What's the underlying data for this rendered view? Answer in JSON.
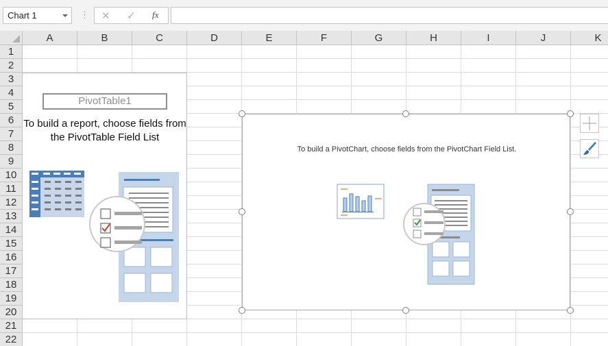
{
  "name_box": {
    "value": "Chart 1"
  },
  "formula_bar": {
    "fx_label": "fx",
    "cancel_glyph": "✕",
    "enter_glyph": "✓",
    "dots": "⋮",
    "value": ""
  },
  "columns": [
    "A",
    "B",
    "C",
    "D",
    "E",
    "F",
    "G",
    "H",
    "I",
    "J",
    "K"
  ],
  "rows": [
    "1",
    "2",
    "3",
    "4",
    "5",
    "6",
    "7",
    "8",
    "9",
    "10",
    "11",
    "12",
    "13",
    "14",
    "15",
    "16",
    "17",
    "18",
    "19",
    "20",
    "21",
    "22"
  ],
  "pivot_table": {
    "name": "PivotTable1",
    "instruction": "To build a report, choose fields from the PivotTable Field List"
  },
  "pivot_chart": {
    "instruction": "To build a PivotChart, choose fields from the PivotChart Field List."
  },
  "side_buttons": [
    {
      "icon": "plus-icon",
      "purpose": "chart-elements"
    },
    {
      "icon": "paintbrush-icon",
      "purpose": "chart-styles"
    }
  ],
  "colors": {
    "accent_blue": "#4a7ebb",
    "panel_blue": "#c5d6ea",
    "check_green": "#3a9a3a",
    "check_red": "#d04a3a"
  }
}
